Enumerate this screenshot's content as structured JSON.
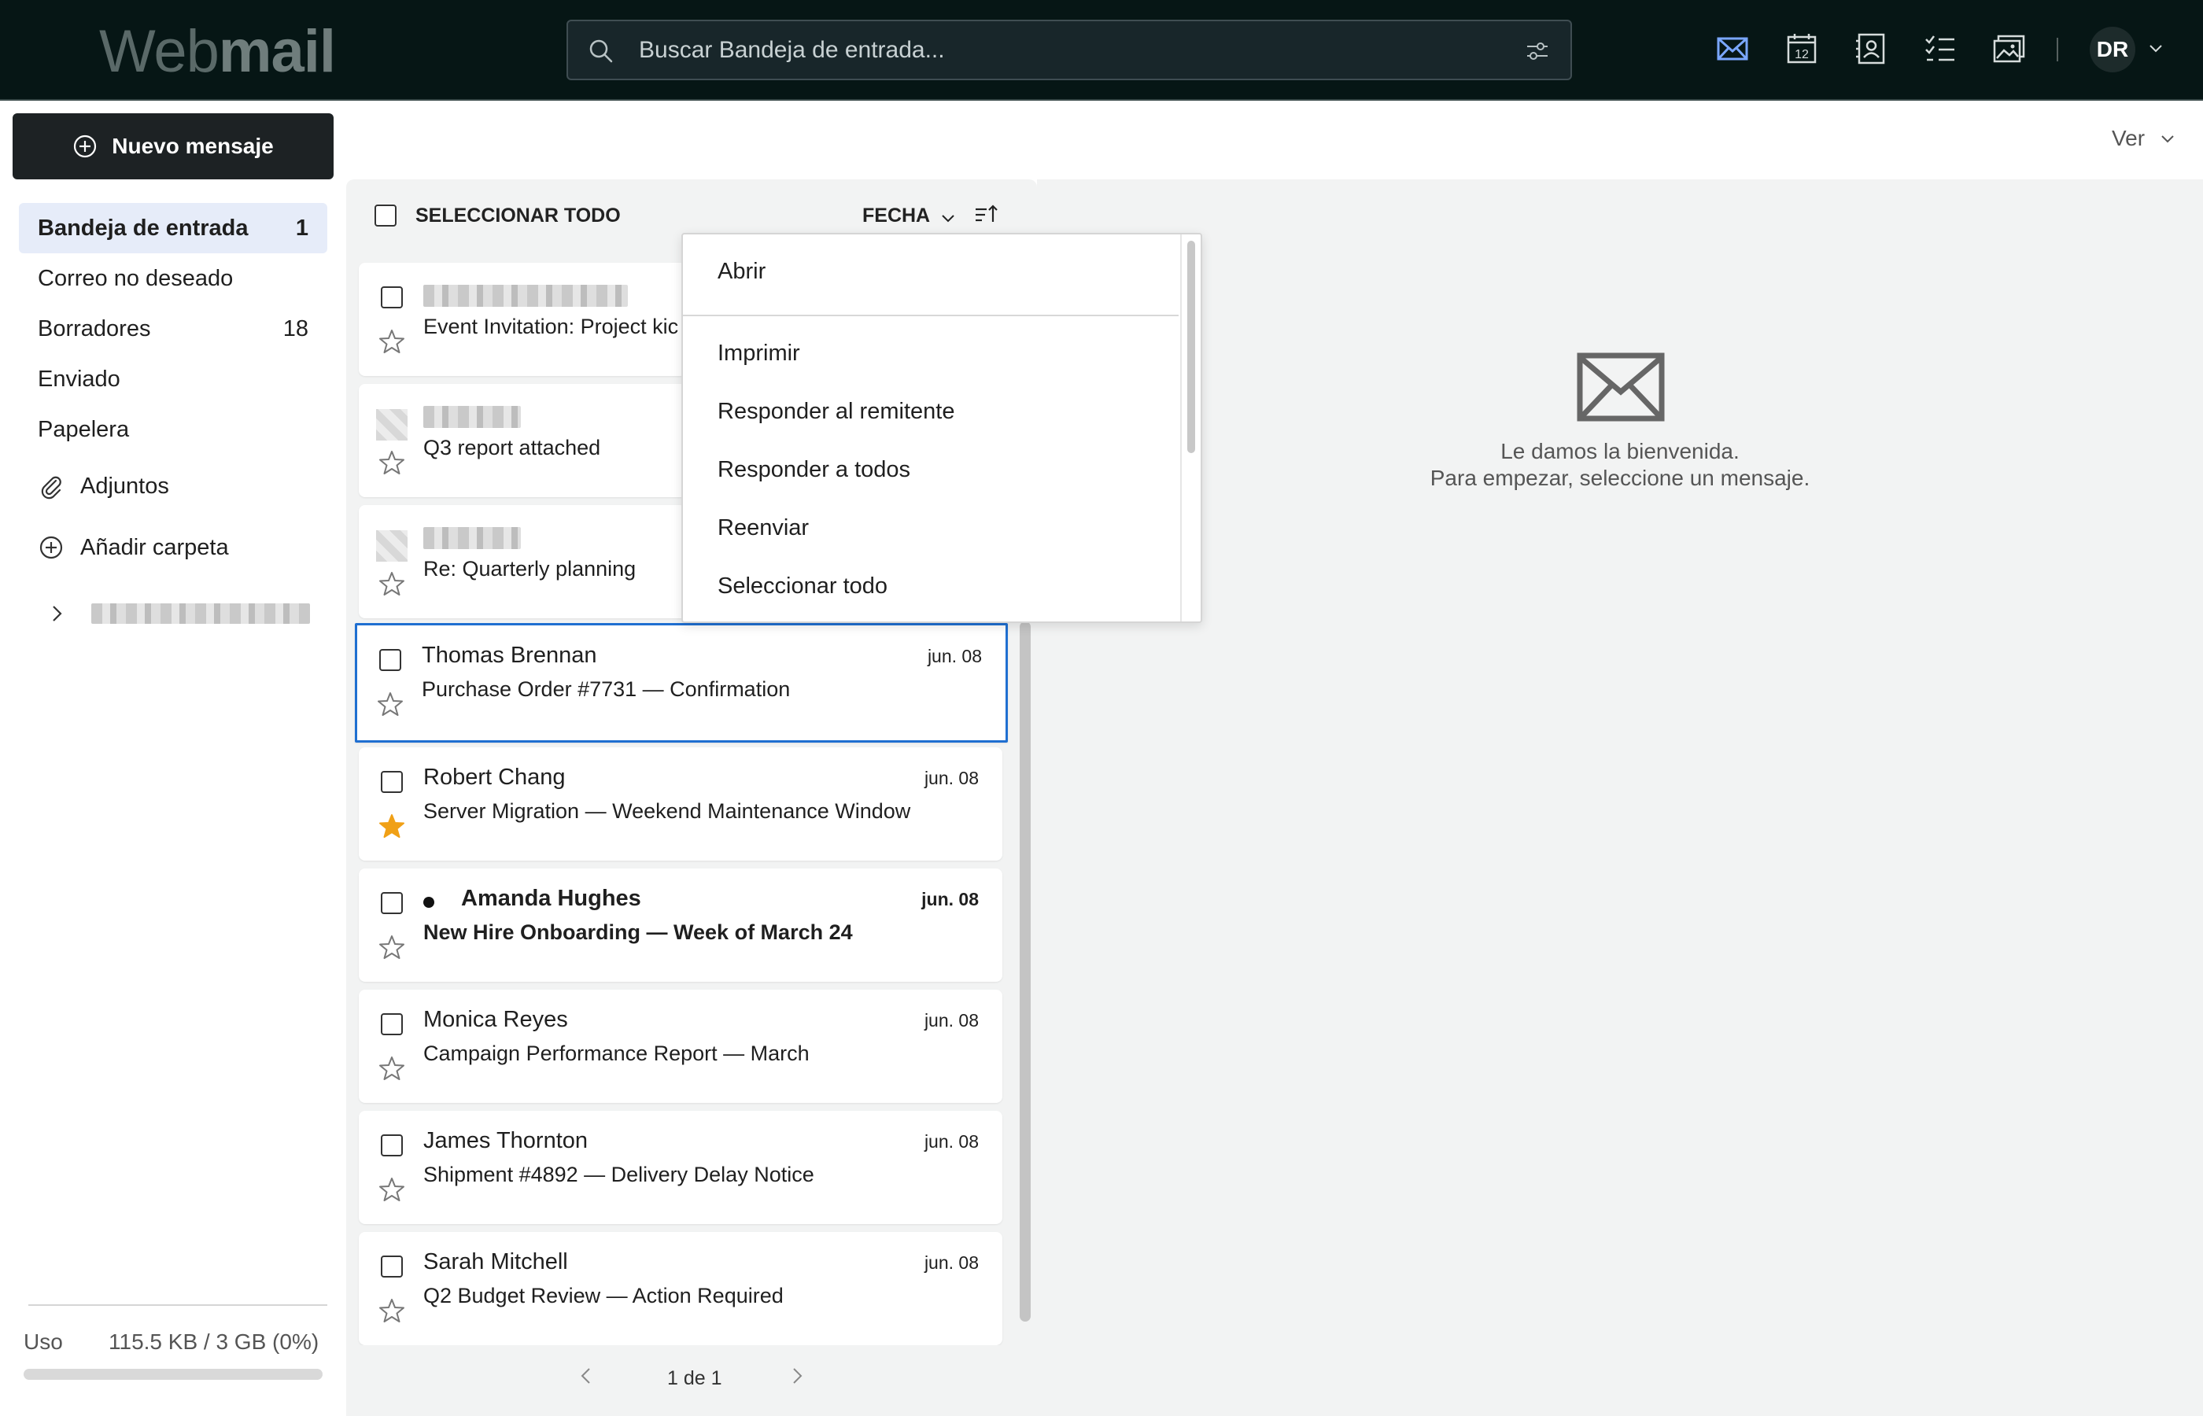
{
  "app": {
    "logo_part1": "Web",
    "logo_part2": "mail"
  },
  "search": {
    "placeholder": "Buscar Bandeja de entrada..."
  },
  "header": {
    "app_icons": [
      "mail-icon",
      "calendar-icon",
      "contacts-icon",
      "tasks-icon",
      "photos-icon"
    ],
    "calendar_day": "12",
    "user_initials": "DR"
  },
  "sidebar": {
    "new_message": "Nuevo mensaje",
    "folders": [
      {
        "label": "Bandeja de entrada",
        "count": "1"
      },
      {
        "label": "Correo no deseado",
        "count": ""
      },
      {
        "label": "Borradores",
        "count": "18"
      },
      {
        "label": "Enviado",
        "count": ""
      },
      {
        "label": "Papelera",
        "count": ""
      }
    ],
    "attachments": "Adjuntos",
    "add_folder": "Añadir carpeta",
    "usage_label": "Uso",
    "usage_value": "115.5 KB / 3 GB (0%)",
    "usage_fraction": 0.0
  },
  "view": {
    "label": "Ver"
  },
  "list": {
    "select_all": "SELECCIONAR TODO",
    "sort_by": "FECHA",
    "messages": [
      {
        "sender": "",
        "subject": "Event Invitation: Project kic",
        "date": "",
        "starred": false,
        "unread": false
      },
      {
        "sender": "",
        "subject": "Q3 report attached",
        "date": "",
        "starred": false,
        "unread": false
      },
      {
        "sender": "",
        "subject": "Re: Quarterly planning",
        "date": "",
        "starred": false,
        "unread": false
      },
      {
        "sender": "Thomas Brennan",
        "subject": "Purchase Order #7731 — Confirmation",
        "date": "jun. 08",
        "starred": false,
        "unread": false
      },
      {
        "sender": "Robert Chang",
        "subject": "Server Migration — Weekend Maintenance Window",
        "date": "jun. 08",
        "starred": true,
        "unread": false
      },
      {
        "sender": "Amanda Hughes",
        "subject": "New Hire Onboarding — Week of March 24",
        "date": "jun. 08",
        "starred": false,
        "unread": true
      },
      {
        "sender": "Monica Reyes",
        "subject": "Campaign Performance Report — March",
        "date": "jun. 08",
        "starred": false,
        "unread": false
      },
      {
        "sender": "James Thornton",
        "subject": "Shipment #4892 — Delivery Delay Notice",
        "date": "jun. 08",
        "starred": false,
        "unread": false
      },
      {
        "sender": "Sarah Mitchell",
        "subject": "Q2 Budget Review — Action Required",
        "date": "jun. 08",
        "starred": false,
        "unread": false
      }
    ],
    "pager": "1 de 1"
  },
  "context_menu": {
    "items": [
      "Abrir",
      "Imprimir",
      "Responder al remitente",
      "Responder a todos",
      "Reenviar",
      "Seleccionar todo"
    ]
  },
  "reading_pane": {
    "line1": "Le damos la bienvenida.",
    "line2": "Para empezar, seleccione un mensaje."
  },
  "colors": {
    "topbar": "#061615",
    "accent": "#1f6fd1",
    "star": "#f0a016",
    "active_folder": "#e6ecf9"
  }
}
